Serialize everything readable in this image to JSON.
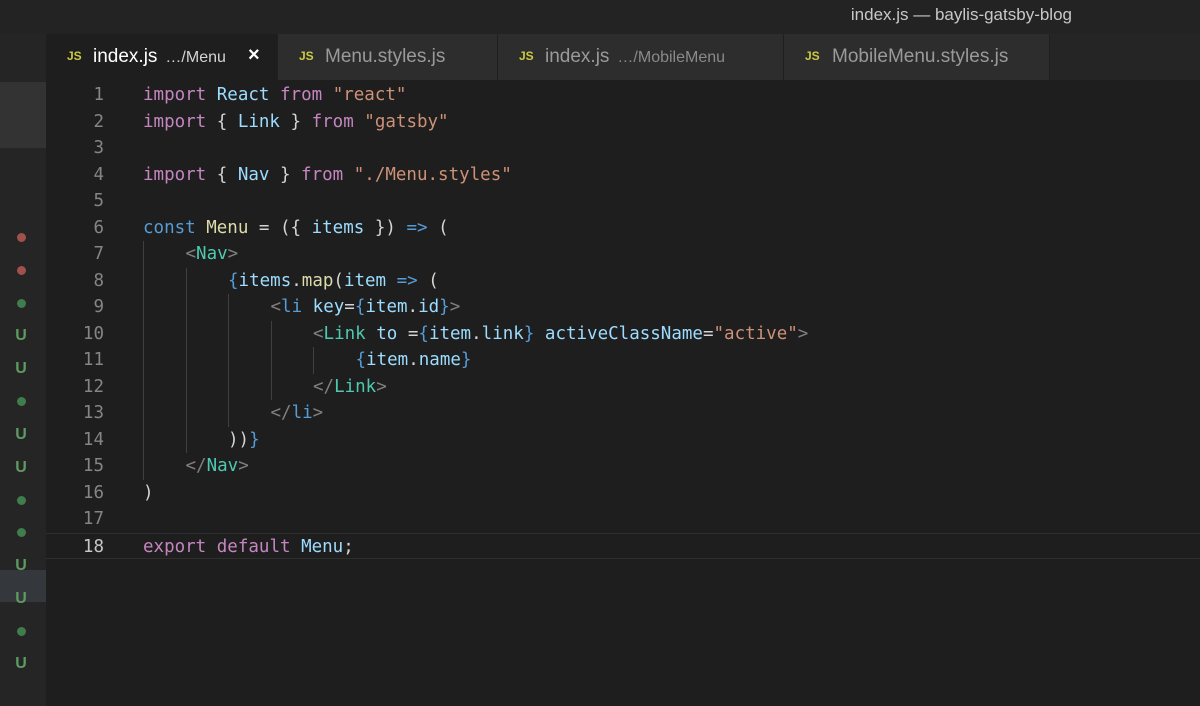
{
  "window": {
    "title": "index.js — baylis-gatsby-blog"
  },
  "tabs": [
    {
      "icon": "JS",
      "name": "index.js",
      "desc": "…/Menu",
      "close": "×",
      "active": true
    },
    {
      "icon": "JS",
      "name": "Menu.styles.js",
      "desc": "",
      "active": false
    },
    {
      "icon": "JS",
      "name": "index.js",
      "desc": "…/MobileMenu",
      "active": false
    },
    {
      "icon": "JS",
      "name": "MobileMenu.styles.js",
      "desc": "",
      "active": false
    }
  ],
  "gutter_status": [
    {
      "type": "dot",
      "color": "#a1514c"
    },
    {
      "type": "dot",
      "color": "#a1514c"
    },
    {
      "type": "dot",
      "color": "#3f7d4c"
    },
    {
      "type": "letter",
      "text": "U",
      "color": "#5e9a62"
    },
    {
      "type": "letter",
      "text": "U",
      "color": "#5e9a62"
    },
    {
      "type": "dot",
      "color": "#3f7d4c"
    },
    {
      "type": "letter",
      "text": "U",
      "color": "#5e9a62"
    },
    {
      "type": "letter",
      "text": "U",
      "color": "#5e9a62"
    },
    {
      "type": "dot",
      "color": "#3f7d4c"
    },
    {
      "type": "dot",
      "color": "#3f7d4c"
    },
    {
      "type": "letter",
      "text": "U",
      "color": "#5e9a62"
    },
    {
      "type": "letter",
      "text": "U",
      "color": "#5e9a62"
    },
    {
      "type": "dot",
      "color": "#3f7d4c"
    },
    {
      "type": "letter",
      "text": "U",
      "color": "#5e9a62"
    }
  ],
  "editor": {
    "current_line": 18,
    "lines": [
      {
        "n": "1",
        "indent": 0,
        "tokens": [
          [
            "kw",
            "import"
          ],
          [
            "pl",
            " "
          ],
          [
            "id",
            "React"
          ],
          [
            "pl",
            " "
          ],
          [
            "kw",
            "from"
          ],
          [
            "pl",
            " "
          ],
          [
            "st",
            "\"react\""
          ]
        ]
      },
      {
        "n": "2",
        "indent": 0,
        "tokens": [
          [
            "kw",
            "import"
          ],
          [
            "pl",
            " { "
          ],
          [
            "id",
            "Link"
          ],
          [
            "pl",
            " } "
          ],
          [
            "kw",
            "from"
          ],
          [
            "pl",
            " "
          ],
          [
            "st",
            "\"gatsby\""
          ]
        ]
      },
      {
        "n": "3",
        "indent": 0,
        "tokens": []
      },
      {
        "n": "4",
        "indent": 0,
        "tokens": [
          [
            "kw",
            "import"
          ],
          [
            "pl",
            " { "
          ],
          [
            "id",
            "Nav"
          ],
          [
            "pl",
            " } "
          ],
          [
            "kw",
            "from"
          ],
          [
            "pl",
            " "
          ],
          [
            "st",
            "\"./Menu.styles\""
          ]
        ]
      },
      {
        "n": "5",
        "indent": 0,
        "tokens": []
      },
      {
        "n": "6",
        "indent": 0,
        "tokens": [
          [
            "br",
            "const"
          ],
          [
            "pl",
            " "
          ],
          [
            "fn",
            "Menu"
          ],
          [
            "pl",
            " = ({ "
          ],
          [
            "id",
            "items"
          ],
          [
            "pl",
            " }) "
          ],
          [
            "br",
            "=>"
          ],
          [
            "pl",
            " ("
          ]
        ]
      },
      {
        "n": "7",
        "indent": 1,
        "tokens": [
          [
            "an",
            "<"
          ],
          [
            "tg",
            "Nav"
          ],
          [
            "an",
            ">"
          ]
        ]
      },
      {
        "n": "8",
        "indent": 2,
        "tokens": [
          [
            "br",
            "{"
          ],
          [
            "id",
            "items"
          ],
          [
            "pl",
            "."
          ],
          [
            "fn",
            "map"
          ],
          [
            "pl",
            "("
          ],
          [
            "id",
            "item"
          ],
          [
            "pl",
            " "
          ],
          [
            "br",
            "=>"
          ],
          [
            "pl",
            " ("
          ]
        ]
      },
      {
        "n": "9",
        "indent": 3,
        "tokens": [
          [
            "an",
            "<"
          ],
          [
            "br",
            "li"
          ],
          [
            "pl",
            " "
          ],
          [
            "id",
            "key"
          ],
          [
            "pl",
            "="
          ],
          [
            "br",
            "{"
          ],
          [
            "id",
            "item"
          ],
          [
            "pl",
            "."
          ],
          [
            "id",
            "id"
          ],
          [
            "br",
            "}"
          ],
          [
            "an",
            ">"
          ]
        ]
      },
      {
        "n": "10",
        "indent": 4,
        "tokens": [
          [
            "an",
            "<"
          ],
          [
            "tg",
            "Link"
          ],
          [
            "pl",
            " "
          ],
          [
            "id",
            "to"
          ],
          [
            "pl",
            " ="
          ],
          [
            "br",
            "{"
          ],
          [
            "id",
            "item"
          ],
          [
            "pl",
            "."
          ],
          [
            "id",
            "link"
          ],
          [
            "br",
            "}"
          ],
          [
            "pl",
            " "
          ],
          [
            "id",
            "activeClassName"
          ],
          [
            "pl",
            "="
          ],
          [
            "st",
            "\"active\""
          ],
          [
            "an",
            ">"
          ]
        ]
      },
      {
        "n": "11",
        "indent": 5,
        "tokens": [
          [
            "br",
            "{"
          ],
          [
            "id",
            "item"
          ],
          [
            "pl",
            "."
          ],
          [
            "id",
            "name"
          ],
          [
            "br",
            "}"
          ]
        ]
      },
      {
        "n": "12",
        "indent": 4,
        "tokens": [
          [
            "an",
            "</"
          ],
          [
            "tg",
            "Link"
          ],
          [
            "an",
            ">"
          ]
        ]
      },
      {
        "n": "13",
        "indent": 3,
        "tokens": [
          [
            "an",
            "</"
          ],
          [
            "br",
            "li"
          ],
          [
            "an",
            ">"
          ]
        ]
      },
      {
        "n": "14",
        "indent": 2,
        "tokens": [
          [
            "pl",
            "))"
          ],
          [
            "br",
            "}"
          ]
        ]
      },
      {
        "n": "15",
        "indent": 1,
        "tokens": [
          [
            "an",
            "</"
          ],
          [
            "tg",
            "Nav"
          ],
          [
            "an",
            ">"
          ]
        ]
      },
      {
        "n": "16",
        "indent": 0,
        "tokens": [
          [
            "pl",
            ")"
          ]
        ]
      },
      {
        "n": "17",
        "indent": 0,
        "tokens": []
      },
      {
        "n": "18",
        "indent": 0,
        "tokens": [
          [
            "kw",
            "export"
          ],
          [
            "pl",
            " "
          ],
          [
            "kw",
            "default"
          ],
          [
            "pl",
            " "
          ],
          [
            "id",
            "Menu"
          ],
          [
            "pl",
            ";"
          ]
        ]
      }
    ]
  }
}
